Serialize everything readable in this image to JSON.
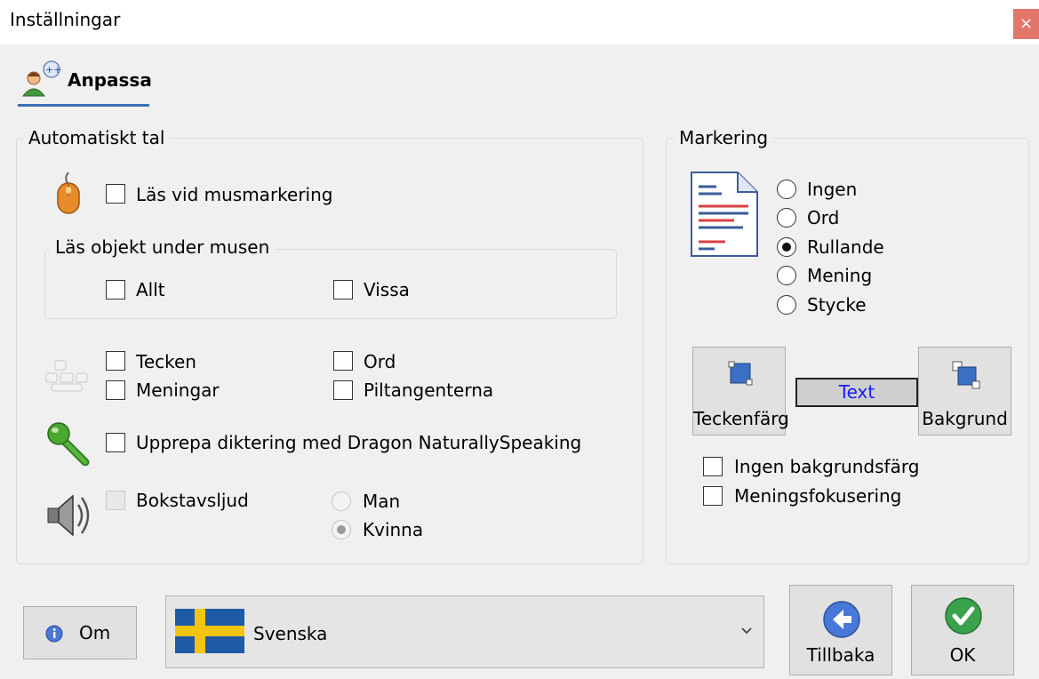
{
  "window": {
    "title": "Inställningar",
    "close_label": "×"
  },
  "tab": {
    "label": "Anpassa",
    "icon": "user-speech-icon"
  },
  "auto_speech": {
    "title": "Automatiskt tal",
    "read_on_mouse_selection": {
      "label": "Läs vid musmarkering",
      "checked": false
    },
    "read_under_mouse": {
      "title": "Läs objekt under musen",
      "all": {
        "label": "Allt",
        "checked": false
      },
      "some": {
        "label": "Vissa",
        "checked": false
      }
    },
    "keys": {
      "characters": {
        "label": "Tecken",
        "checked": false
      },
      "words": {
        "label": "Ord",
        "checked": false
      },
      "sentences": {
        "label": "Meningar",
        "checked": false
      },
      "arrow_keys": {
        "label": "Piltangenterna",
        "checked": false
      }
    },
    "dragon": {
      "label": "Upprepa diktering med Dragon NaturallySpeaking",
      "checked": false
    },
    "letter_sound": {
      "label": "Bokstavsljud",
      "checked": false,
      "man": "Man",
      "woman": "Kvinna",
      "selected": "Kvinna"
    }
  },
  "highlight": {
    "title": "Markering",
    "options": [
      "Ingen",
      "Ord",
      "Rullande",
      "Mening",
      "Stycke"
    ],
    "selected": "Rullande",
    "text_color_label": "Teckenfärg",
    "background_label": "Bakgrund",
    "preview_text": "Text",
    "no_background": {
      "label": "Ingen bakgrundsfärg",
      "checked": false
    },
    "sentence_focus": {
      "label": "Meningsfokusering",
      "checked": false
    }
  },
  "footer": {
    "about_label": "Om",
    "language": "Svenska",
    "back_label": "Tillbaka",
    "ok_label": "OK"
  },
  "colors": {
    "tab_underline": "#3d6fb4",
    "close_bg": "#e3766a",
    "flag_blue": "#1f5aa6",
    "flag_yellow": "#f3c511",
    "ok_green": "#3aa24b",
    "back_blue": "#4a78d8"
  }
}
